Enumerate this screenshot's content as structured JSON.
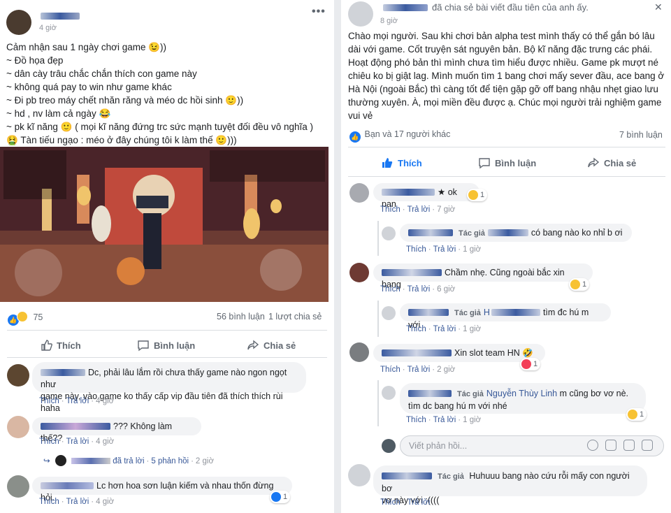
{
  "left_post": {
    "time": "4 giờ",
    "lines": [
      "Cảm nhận sau 1 ngày chơi game 😉))",
      "~ Đồ họa đẹp",
      "~ dân cày trâu chắc chắn thích con game này",
      "~ không quá pay to win như game khác",
      "~ Đi pb treo máy chết nhăn răng và méo dc hồi sinh 🙂))",
      "~ hd , nv làm cả ngày 😂",
      "~ pk kĩ năng 🙂 ( mọi kĩ năng đứng trc sức mạnh tuyệt đối đều vô nghĩa )",
      "🤮 Tàn tiếu ngạo : méo ở đây chúng tôi k làm thế 🙂)))"
    ],
    "reaction_count": "75",
    "comment_count": "56 bình luận",
    "share_count": "1 lượt chia sẻ",
    "actions": {
      "like": "Thích",
      "comment": "Bình luận",
      "share": "Chia sẻ"
    },
    "comments": [
      {
        "text": "Dc, phải lâu lắm rồi chưa thấy game nào ngon ngọt như",
        "text2": "game này, vào game ko thấy cấp vip đầu tiên đã thích thích rùi haha",
        "time": "4 giờ"
      },
      {
        "text": "??? Không làm thế??",
        "time": "4 giờ",
        "replied": "đã trả lời",
        "replies": "5 phản hồi",
        "reply_time": "2 giờ"
      },
      {
        "text": "Lc hơn hoa sơn luận kiếm và nhau thốn đừng hỏi.",
        "time": "4 giờ",
        "react_count": "1"
      }
    ],
    "comment_like": "Thích",
    "comment_reply": "Trả lời"
  },
  "right_post": {
    "header_action": "đã chia sẻ bài viết đầu tiên của anh ấy.",
    "time": "8 giờ",
    "lines": [
      "Chào mọi người. Sau khi chơi bản alpha test mình thấy có thể gắn bó lâu",
      "dài với game. Cốt truyện sát nguyên bản. Bộ kĩ năng đặc trưng các phái.",
      "Hoạt động phó bản thì mình chưa tìm hiểu được nhiều. Game pk mượt né",
      "chiêu ko bị giật lag. Mình muốn tìm 1 bang chơi mấy sever đầu, ace bang ở",
      "Hà Nội (ngoài Bắc) thì càng tốt để tiện gặp gỡ off bang nhậu nhẹt giao lưu",
      "thường xuyên. À, mọi miền đều được ạ. Chúc mọi người trải nghiệm game",
      "vui vẻ"
    ],
    "likes_text": "Bạn và 17 người khác",
    "comment_count": "7 bình luận",
    "actions": {
      "like": "Thích",
      "comment": "Bình luận",
      "share": "Chia sẻ"
    },
    "author_tag": "Tác giả",
    "comments": [
      {
        "text": "ok pan",
        "time": "7 giờ",
        "react_count": "1"
      },
      {
        "text": "có bang nào ko nhỉ b ơi",
        "time": "1 giờ",
        "reply": true
      },
      {
        "text": "Chầm nhẹ. Cũng ngoài bắc xin bang",
        "time": "6 giờ",
        "react_count": "1"
      },
      {
        "text": "tìm đc hú m với",
        "time": "1 giờ",
        "reply": true,
        "prefix": "H"
      },
      {
        "text": "Xin slot team HN 🤣",
        "time": "2 giờ",
        "react_count": "1"
      },
      {
        "text": "m cũng bơ vơ nè.",
        "text2": "tìm dc bang hú m với nhé",
        "time": "1 giờ",
        "reply": true,
        "prefix": "Nguyễn Thùy Linh",
        "react_count": "1"
      },
      {
        "text": "Huhuuu bang nào cứu rỗi mấy con người bơ",
        "text2": "vơ này với ;((((",
        "time": ""
      }
    ],
    "reply_placeholder": "Viết phản hồi...",
    "comment_like": "Thích",
    "comment_reply": "Trả lời"
  },
  "colors": {
    "link": "#385898",
    "blue": "#1877f2",
    "bg": "#e9ebee"
  }
}
